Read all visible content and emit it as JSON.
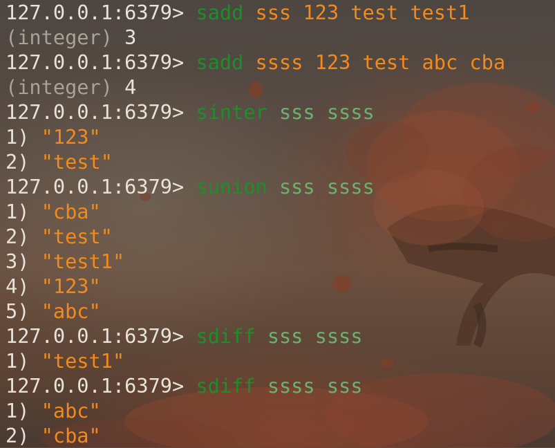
{
  "prompt": "127.0.0.1:6379>",
  "colors": {
    "prompt": "#e8e2d8",
    "command": "#1e8e2a",
    "string_arg": "#f28a1e",
    "key_arg": "#6fb071",
    "integer_label": "#a8a29a"
  },
  "lines": [
    {
      "type": "command",
      "prompt": "127.0.0.1:6379>",
      "command": "sadd",
      "args": "sss 123 test test1",
      "args_style": "orange"
    },
    {
      "type": "integer",
      "label": "(integer)",
      "value": "3"
    },
    {
      "type": "command",
      "prompt": "127.0.0.1:6379>",
      "command": "sadd",
      "args": "ssss 123 test abc cba",
      "args_style": "orange"
    },
    {
      "type": "integer",
      "label": "(integer)",
      "value": "4"
    },
    {
      "type": "command",
      "prompt": "127.0.0.1:6379>",
      "command": "sinter",
      "args": "sss ssss",
      "args_style": "green"
    },
    {
      "type": "item",
      "index": "1)",
      "value": "\"123\""
    },
    {
      "type": "item",
      "index": "2)",
      "value": "\"test\""
    },
    {
      "type": "command",
      "prompt": "127.0.0.1:6379>",
      "command": "sunion",
      "args": "sss ssss",
      "args_style": "green"
    },
    {
      "type": "item",
      "index": "1)",
      "value": "\"cba\""
    },
    {
      "type": "item",
      "index": "2)",
      "value": "\"test\""
    },
    {
      "type": "item",
      "index": "3)",
      "value": "\"test1\""
    },
    {
      "type": "item",
      "index": "4)",
      "value": "\"123\""
    },
    {
      "type": "item",
      "index": "5)",
      "value": "\"abc\""
    },
    {
      "type": "command",
      "prompt": "127.0.0.1:6379>",
      "command": "sdiff",
      "args": "sss ssss",
      "args_style": "green"
    },
    {
      "type": "item",
      "index": "1)",
      "value": "\"test1\""
    },
    {
      "type": "command",
      "prompt": "127.0.0.1:6379>",
      "command": "sdiff",
      "args": "ssss sss",
      "args_style": "green"
    },
    {
      "type": "item",
      "index": "1)",
      "value": "\"abc\""
    },
    {
      "type": "item",
      "index": "2)",
      "value": "\"cba\""
    }
  ]
}
